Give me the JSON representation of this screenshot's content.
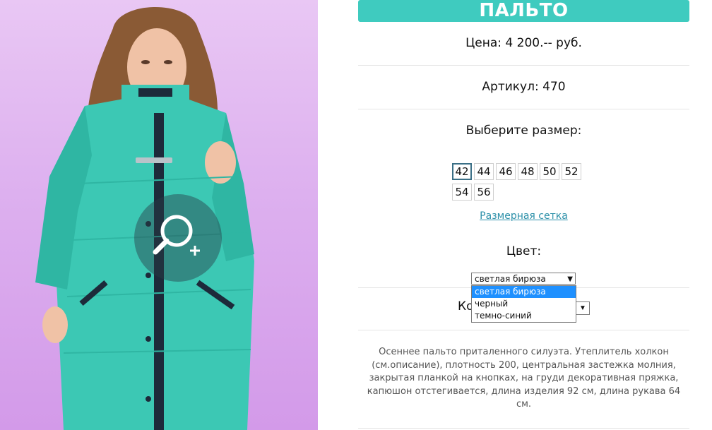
{
  "product": {
    "title": "ПАЛЬТО",
    "price": "Цена: 4 200.-- руб.",
    "article": "Артикул: 470",
    "size_heading": "Выберите размер:",
    "sizes": [
      "42",
      "44",
      "46",
      "48",
      "50",
      "52",
      "54",
      "56"
    ],
    "selected_size": "42",
    "size_chart_link": "Размерная сетка",
    "color_heading": "Цвет:",
    "color_select": {
      "value": "светлая бирюза",
      "options": [
        "светлая бирюза",
        "черный",
        "темно-синий"
      ]
    },
    "quantity_label": "Ко",
    "description": "Осеннее пальто приталенного силуэта. Утеплитель холкон (см.описание), плотность 200, центральная застежка молния, закрытая планкой на кнопках, на груди декоративная пряжка, капюшон отстегивается, длина изделия 92 см, длина рукава 64 см."
  },
  "icons": {
    "zoom": "magnifier-plus-icon",
    "select_arrow": "triangle-down-icon"
  },
  "colors": {
    "accent": "#3fcbbf",
    "link": "#2a8fa8",
    "photo_background": "#ddb0ef",
    "coat": "#3cc8b4",
    "dropdown_highlight": "#1e90ff"
  }
}
